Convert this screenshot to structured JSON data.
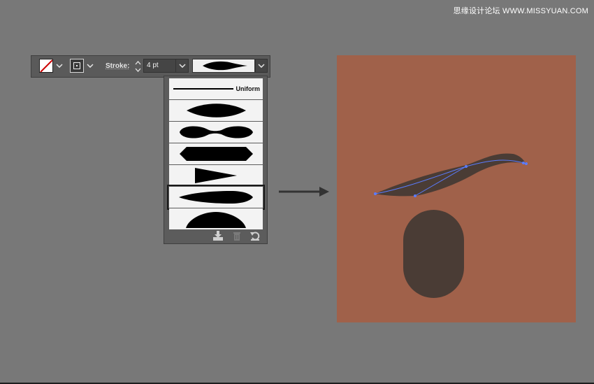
{
  "watermark": "思缘设计论坛 WWW.MISSYUAN.COM",
  "control_bar": {
    "fill_swatch": "none",
    "stroke_label": "Stroke:",
    "stroke_weight": "4 pt",
    "profile_selected": "Width Profile 2"
  },
  "profile_panel": {
    "items": [
      {
        "name": "Uniform",
        "label": "Uniform"
      },
      {
        "name": "Width Profile 1"
      },
      {
        "name": "Width Profile 2"
      },
      {
        "name": "Width Profile 3"
      },
      {
        "name": "Width Profile 4"
      },
      {
        "name": "Width Profile 5",
        "selected": true
      },
      {
        "name": "Width Profile 6"
      }
    ],
    "icons": [
      "add-to-profiles-icon",
      "delete-profile-icon",
      "reset-profiles-icon"
    ]
  },
  "colors": {
    "background": "#787878",
    "artboard": "#a0614a",
    "shape": "#4a3c35",
    "path_accent": "#5b7cff",
    "none_slash": "#cc0000"
  },
  "artboard": {
    "shapes": [
      "eyebrow-stroke",
      "rounded-capsule"
    ]
  }
}
